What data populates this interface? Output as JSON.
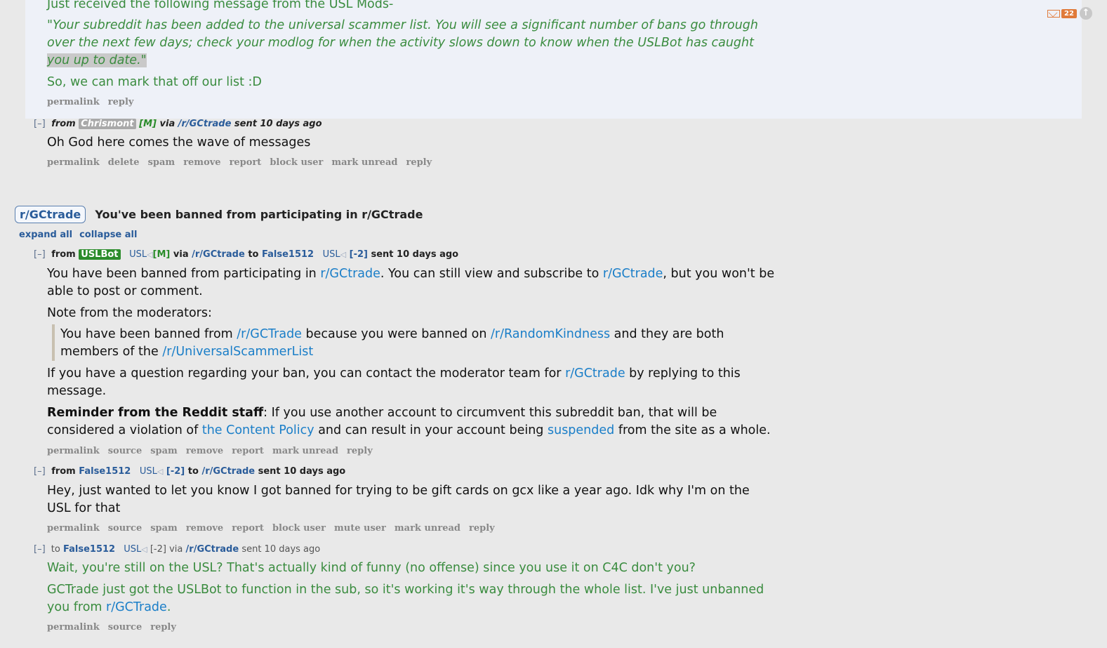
{
  "top_message": {
    "line0": "Just received the following message from the USL Mods-",
    "quote_line1": "\"Your subreddit has been added to the universal scammer list. You will see a significant number of bans go through",
    "quote_line2": "over the next few days; check your modlog for when the activity slows down to know when the USLBot has caught",
    "quote_line3": "you up to date.\"",
    "closing": "So, we can mark that off our list :D",
    "actions": [
      "permalink",
      "reply"
    ]
  },
  "msg_chrismont": {
    "toggle": "[–]",
    "from_label": "from",
    "author": "Chrismont",
    "mod_tag": "[M]",
    "via_label": "via",
    "subreddit": "/r/GCtrade",
    "time": "sent 10 days ago",
    "body": "Oh God here comes the wave of messages",
    "actions": [
      "permalink",
      "delete",
      "spam",
      "remove",
      "report",
      "block user",
      "mark unread",
      "reply"
    ]
  },
  "thread": {
    "subreddit_pill": "r/GCtrade",
    "title": "You've been banned from participating in r/GCtrade",
    "expand_all": "expand all",
    "collapse_all": "collapse all"
  },
  "msg_uslbot": {
    "toggle": "[–]",
    "from_label": "from",
    "author": "USLBot",
    "author_flair": "USL",
    "mod_tag": "[M]",
    "via_label": "via",
    "subreddit": "/r/GCtrade",
    "to_label": "to",
    "recipient": "False1512",
    "recipient_flair": "USL",
    "karma": "[-2]",
    "time": "sent 10 days ago",
    "p1_a": "You have been banned from participating in ",
    "p1_link1": "r/GCtrade",
    "p1_b": ". You can still view and subscribe to ",
    "p1_link2": "r/GCtrade",
    "p1_c": ", but you won't be",
    "p1_line2": "able to post or comment.",
    "p2": "Note from the moderators:",
    "q_a": "You have been banned from ",
    "q_link1": "/r/GCTrade",
    "q_b": " because you were banned on ",
    "q_link2": "/r/RandomKindness",
    "q_c": " and they are both",
    "q_line2_a": "members of the ",
    "q_link3": "/r/UniversalScammerList",
    "p3_a": "If you have a question regarding your ban, you can contact the moderator team for ",
    "p3_link": "r/GCtrade",
    "p3_b": " by replying to this",
    "p3_line2": "message.",
    "p4_bold": "Reminder from the Reddit staff",
    "p4_a": ": If you use another account to circumvent this subreddit ban, that will be",
    "p4_line2_a": "considered a violation of ",
    "p4_link1": "the Content Policy",
    "p4_line2_b": " and can result in your account being ",
    "p4_link2": "suspended",
    "p4_line2_c": " from the site as a whole.",
    "actions": [
      "permalink",
      "source",
      "spam",
      "remove",
      "report",
      "mark unread",
      "reply"
    ]
  },
  "msg_false1512": {
    "toggle": "[–]",
    "from_label": "from",
    "author": "False1512",
    "author_flair": "USL",
    "karma": "[-2]",
    "to_label": "to",
    "subreddit": "/r/GCtrade",
    "time": "sent 10 days ago",
    "line1": "Hey, just wanted to let you know I got banned for trying to be gift cards on gcx like a year ago. Idk why I'm on the",
    "line2": "USL for that",
    "actions": [
      "permalink",
      "source",
      "spam",
      "remove",
      "report",
      "block user",
      "mute user",
      "mark unread",
      "reply"
    ]
  },
  "msg_reply": {
    "toggle": "[–]",
    "to_label": "to",
    "recipient": "False1512",
    "recipient_flair": "USL",
    "karma": "[-2]",
    "via_label": "via",
    "subreddit": "/r/GCtrade",
    "time": "sent 10 days ago",
    "line1": "Wait, you're still on the USL? That's actually kind of funny (no offense) since you use it on C4C don't you?",
    "line2": "GCTrade just got the USLBot to function in the sub, so it's working it's way through the whole list. I've just unbanned",
    "line3_a": "you from ",
    "line3_link": "r/GCTrade",
    "line3_b": ".",
    "actions": [
      "permalink",
      "source",
      "reply"
    ]
  },
  "header_widgets": {
    "mail_count": "22",
    "mail_icon": "envelope-icon",
    "scroll_top_icon": "arrow-up-circle-icon"
  },
  "colors": {
    "mod_green": "#3a8c3f",
    "link_blue": "#1a7ec8",
    "mail_orange": "#e07a3a"
  }
}
